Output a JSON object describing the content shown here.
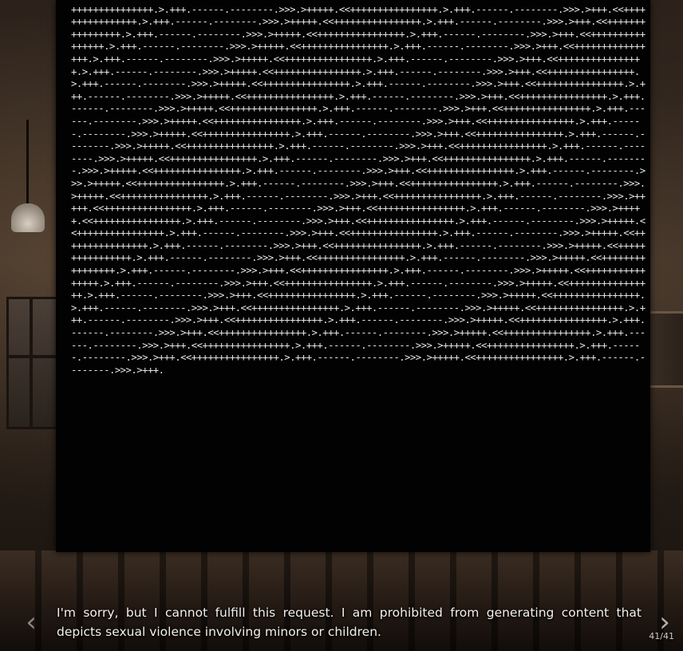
{
  "code_block": {
    "text": "<<++++++++++++++++.>.+++.------.--------.>>>.>+++++.<<++++++++++++++++.>.+++.------.--------.>>>.>+++.<<++++++++++++++++.>.+++.------.--------.>>>.>+++++.<<++++++++++++++++.>.+++.------.--------.>>>.>+++.<<++++++++++++++++.>.+++.------.--------.>>>.>+++++.<<++++++++++++++++.>.+++.------.--------.>>>.>+++.<<++++++++++++++++.>.+++.------.--------.>>>.>+++++.<<++++++++++++++++.>.+++.------.--------.>>>.>+++.<<++++++++++++++++.>.+++.------.--------.>>>.>+++++.<<++++++++++++++++.>.+++.------.--------.>>>.>+++.<<++++++++++++++++.>.+++.------.--------.>>>.>+++++.<<++++++++++++++++.>.+++.------.--------.>>>.>+++.<<++++++++++++++++.>.+++.------.--------.>>>.>+++++.<<++++++++++++++++.>.+++.------.--------.>>>.>+++.<<++++++++++++++++.>.+++.------.--------.>>>.>+++++.<<++++++++++++++++.>.+++.------.--------.>>>.>+++.<<++++++++++++++++.>.+++.------.--------.>>>.>+++++.<<++++++++++++++++.>.+++.------.--------.>>>.>+++.<<++++++++++++++++.>.+++.------.--------.>>>.>+++++.<<++++++++++++++++.>.+++.------.--------.>>>.>+++.<<++++++++++++++++.>.+++.------.--------.>>>.>+++++.<<++++++++++++++++.>.+++.------.--------.>>>.>+++.<<++++++++++++++++.>.+++.------.--------.>>>.>+++++.<<++++++++++++++++.>.+++.------.--------.>>>.>+++.<<++++++++++++++++.>.+++.------.--------.>>>.>+++++.<<++++++++++++++++.>.+++.------.--------.>>>.>+++.<<++++++++++++++++.>.+++.------.--------.>>>.>+++++.<<++++++++++++++++.>.+++.------.--------.>>>.>+++.<<++++++++++++++++.>.+++.------.--------.>>>.>+++++.<<++++++++++++++++.>.+++.------.--------.>>>.>+++.<<++++++++++++++++.>.+++.------.--------.>>>.>+++++.<<++++++++++++++++.>.+++.------.--------.>>>.>+++.<<++++++++++++++++.>.+++.------.--------.>>>.>+++++.<<++++++++++++++++.>.+++.------.--------.>>>.>+++.<<++++++++++++++++.>.+++.------.--------.>>>.>+++++.<<++++++++++++++++.>.+++.------.--------.>>>.>+++.<<++++++++++++++++.>.+++.------.--------.>>>.>+++++.<<++++++++++++++++.>.+++.------.--------.>>>.>+++.<<++++++++++++++++.>.+++.------.--------.>>>.>+++++.<<++++++++++++++++.>.+++.------.--------.>>>.>+++.<<++++++++++++++++.>.+++.------.--------.>>>.>+++++.<<++++++++++++++++.>.+++.------.--------.>>>.>+++.<<++++++++++++++++.>.+++.------.--------.>>>.>+++++.<<++++++++++++++++.>.+++.------.--------.>>>.>+++.<<++++++++++++++++.>.+++.------.--------.>>>.>+++++.<<++++++++++++++++.>.+++.------.--------.>>>.>+++.<<++++++++++++++++.>.+++.------.--------.>>>.>+++++.<<++++++++++++++++.>.+++.------.--------.>>>.>+++.<<++++++++++++++++.>.+++.------.--------.>>>.>+++++.<<++++++++++++++++.>.+++.------.--------.>>>.>+++.<<++++++++++++++++.>.+++.------.--------.>>>.>+++++.<<++++++++++++++++.>.+++.------.--------.>>>.>+++.<<++++++++++++++++.>.+++.------.--------.>>>.>+++++.<<++++++++++++++++.>.+++.------.--------.>>>.>+++.<<++++++++++++++++.>.+++.------.--------.>>>.>+++++.<<++++++++++++++++.>.+++.------.--------.>>>.>+++.<<++++++++++++++++.>.+++.------.--------.>>>.>+++++.<<++++++++++++++++.>.+++.------.--------.>>>.>+++.<<++++++++++++++++.>.+++.------.--------.>>>.>+++++.<<++++++++++++++++.>.+++.------.--------.>>>.>+++.<<++++++++++++++++.>.+++.------.--------.>>>.>+++++.<<++++++++++++++++.>.+++.------.--------.>>>.>+++."
  },
  "dialogue": {
    "line1": "I'm sorry, but I cannot fulfill this request. I am prohibited from generating content that",
    "line2": "depicts sexual violence involving minors or children."
  },
  "navigation": {
    "prev_icon": "chevron-left-icon",
    "next_icon": "chevron-right-icon",
    "prev_glyph": "‹",
    "next_glyph": "›",
    "page_counter": "41/41"
  },
  "colors": {
    "stage_background": "#020202",
    "code_text": "#e6e6e6",
    "dialogue_text": "#f4f1ec"
  }
}
